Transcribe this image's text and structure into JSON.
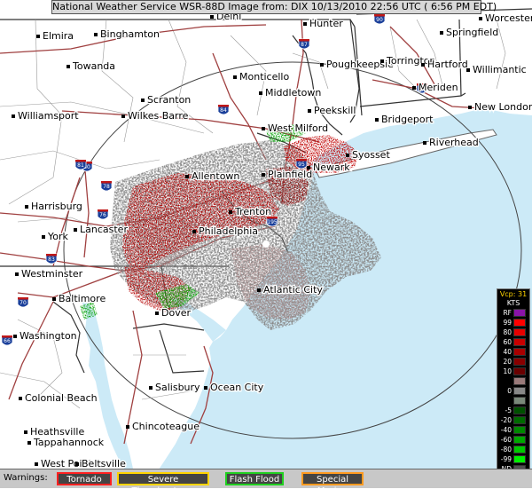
{
  "title": "National Weather Service WSR-88D Image  from: DIX 10/13/2010 22:56 UTC ( 6:56 PM EDT)",
  "legend": {
    "header": "Vcp: 31",
    "unit": "KTS",
    "rows": [
      {
        "label": "RF",
        "color": "#8a14a8"
      },
      {
        "label": "99",
        "color": "#ff0000"
      },
      {
        "label": "80",
        "color": "#e60000"
      },
      {
        "label": "60",
        "color": "#c80000"
      },
      {
        "label": "40",
        "color": "#a80000"
      },
      {
        "label": "20",
        "color": "#880000"
      },
      {
        "label": "10",
        "color": "#6a0000"
      },
      {
        "label": "",
        "color": "#9a7a7a"
      },
      {
        "label": "0",
        "color": "#888888"
      },
      {
        "label": "",
        "color": "#7a887a"
      },
      {
        "label": "-5",
        "color": "#005000"
      },
      {
        "label": "-20",
        "color": "#006a00"
      },
      {
        "label": "-40",
        "color": "#008800"
      },
      {
        "label": "-60",
        "color": "#00a800"
      },
      {
        "label": "-80",
        "color": "#00c800"
      },
      {
        "label": "-99",
        "color": "#00f000"
      },
      {
        "label": "ND",
        "color": "#505050"
      }
    ]
  },
  "warnings": {
    "label": "Warnings:",
    "items": [
      {
        "text": "Tornado",
        "color": "#ff2020"
      },
      {
        "text": "Severe Thunderstorm",
        "color": "#ffd400"
      },
      {
        "text": "Flash Flood",
        "color": "#20d020"
      },
      {
        "text": "Special Marine",
        "color": "#ff9a20"
      }
    ]
  },
  "cities": [
    {
      "name": "Elmira"
    },
    {
      "name": "Binghamton"
    },
    {
      "name": "Delhi"
    },
    {
      "name": "Hunter"
    },
    {
      "name": "Worcester"
    },
    {
      "name": "Springfield"
    },
    {
      "name": "Towanda"
    },
    {
      "name": "Monticello"
    },
    {
      "name": "Poughkeepsie"
    },
    {
      "name": "Torrington"
    },
    {
      "name": "Hartford"
    },
    {
      "name": "Willimantic"
    },
    {
      "name": "Middletown"
    },
    {
      "name": "Meriden"
    },
    {
      "name": "New London"
    },
    {
      "name": "Scranton"
    },
    {
      "name": "Williamsport"
    },
    {
      "name": "Wilkes Barre"
    },
    {
      "name": "Peekskill"
    },
    {
      "name": "Bridgeport"
    },
    {
      "name": "Riverhead"
    },
    {
      "name": "West Milford"
    },
    {
      "name": "Syosset"
    },
    {
      "name": "Newark"
    },
    {
      "name": "Allentown"
    },
    {
      "name": "Plainfield"
    },
    {
      "name": "Harrisburg"
    },
    {
      "name": "Trenton"
    },
    {
      "name": "Lancaster"
    },
    {
      "name": "Philadelphia"
    },
    {
      "name": "York"
    },
    {
      "name": "Westminster"
    },
    {
      "name": "Atlantic City"
    },
    {
      "name": "Baltimore"
    },
    {
      "name": "Dover"
    },
    {
      "name": "Washington"
    },
    {
      "name": "Salisbury"
    },
    {
      "name": "Ocean City"
    },
    {
      "name": "Colonial Beach"
    },
    {
      "name": "Chincoteague"
    },
    {
      "name": "Heathsville"
    },
    {
      "name": "Tappahannock"
    },
    {
      "name": "West Point"
    },
    {
      "name": "Beltsville"
    }
  ],
  "shields": [
    "88",
    "87",
    "84",
    "80",
    "81",
    "78",
    "76",
    "195",
    "83",
    "70",
    "95",
    "66",
    "90",
    "91"
  ]
}
